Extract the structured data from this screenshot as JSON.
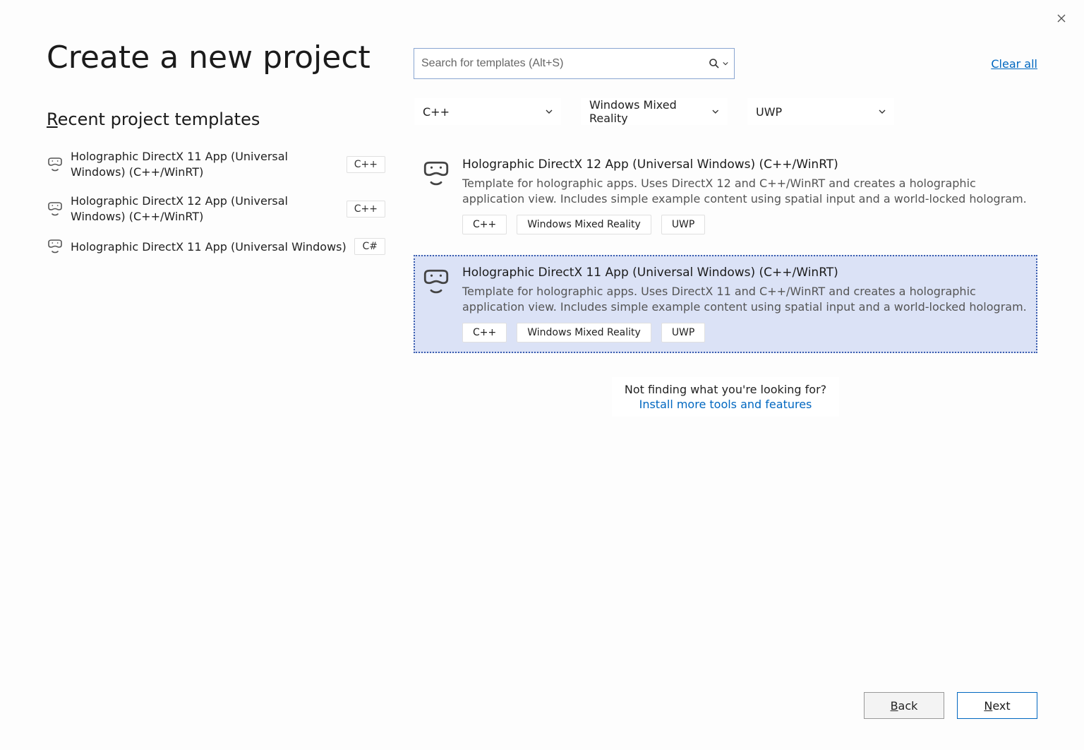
{
  "title": "Create a new project",
  "recent_heading": "Recent project templates",
  "recent": [
    {
      "label": "Holographic DirectX 11 App (Universal Windows) (C++/WinRT)",
      "lang": "C++"
    },
    {
      "label": "Holographic DirectX 12 App (Universal Windows) (C++/WinRT)",
      "lang": "C++"
    },
    {
      "label": "Holographic DirectX 11 App (Universal Windows)",
      "lang": "C#"
    }
  ],
  "search": {
    "placeholder": "Search for templates (Alt+S)",
    "value": ""
  },
  "clear_all_label": "Clear all",
  "filters": {
    "language": "C++",
    "platform": "Windows Mixed Reality",
    "project_type": "UWP"
  },
  "templates": [
    {
      "title": "Holographic DirectX 12 App (Universal Windows) (C++/WinRT)",
      "desc": "Template for holographic apps. Uses DirectX 12 and C++/WinRT and creates a holographic application view. Includes simple example content using spatial input and a world-locked hologram.",
      "tags": [
        "C++",
        "Windows Mixed Reality",
        "UWP"
      ],
      "selected": false
    },
    {
      "title": "Holographic DirectX 11 App (Universal Windows) (C++/WinRT)",
      "desc": "Template for holographic apps. Uses DirectX 11 and C++/WinRT and creates a holographic application view. Includes simple example content using spatial input and a world-locked hologram.",
      "tags": [
        "C++",
        "Windows Mixed Reality",
        "UWP"
      ],
      "selected": true
    }
  ],
  "not_finding": {
    "line1": "Not finding what you're looking for?",
    "line2": "Install more tools and features"
  },
  "buttons": {
    "back": "Back",
    "next": "Next"
  }
}
